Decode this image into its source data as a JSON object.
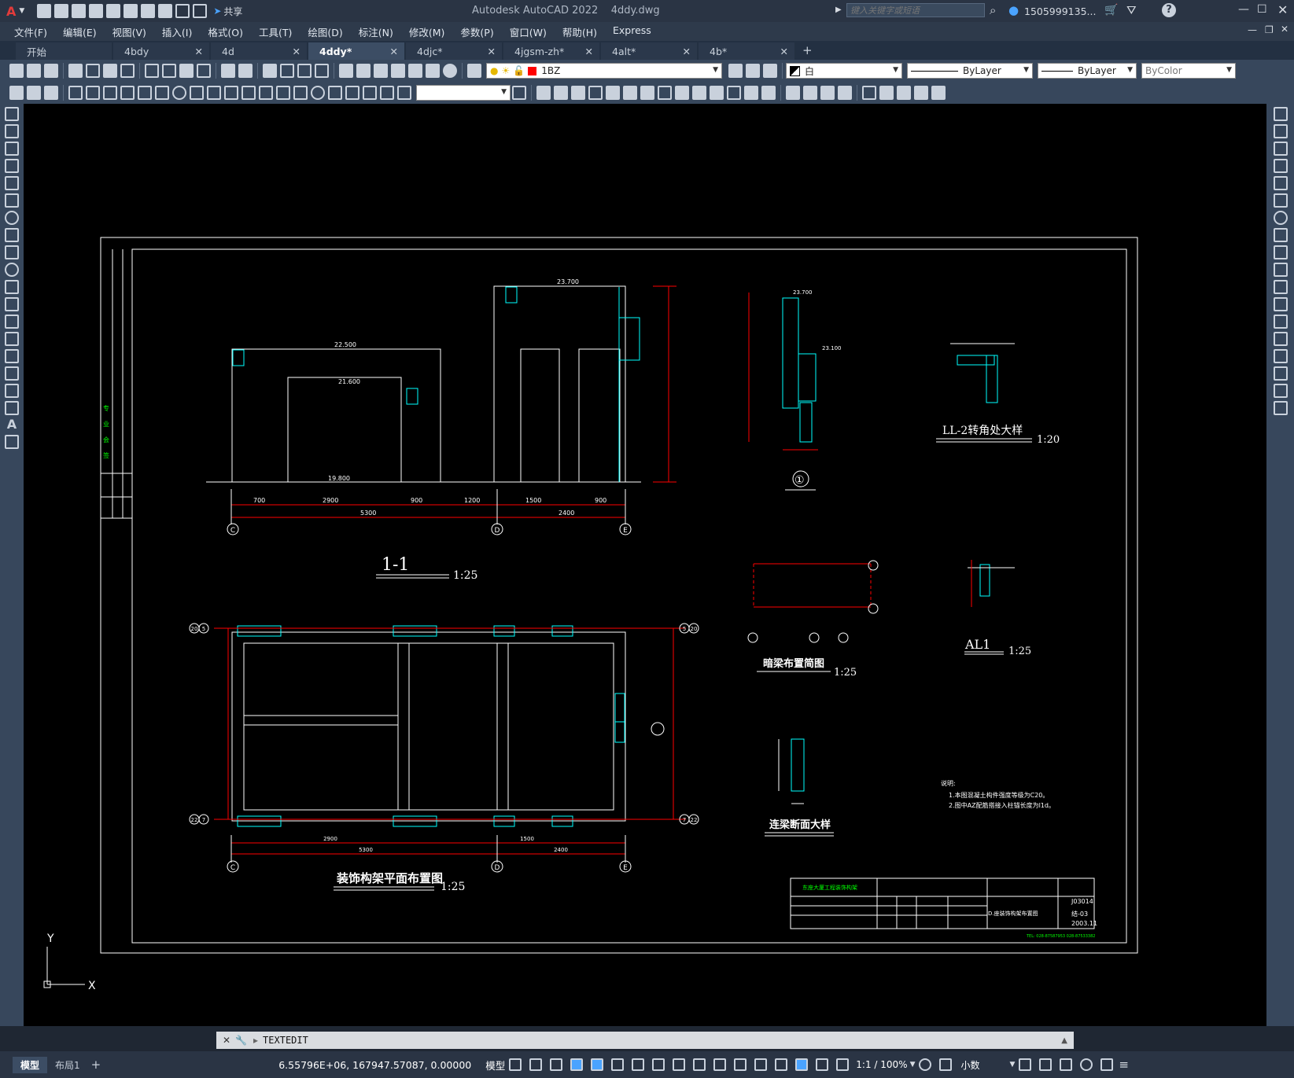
{
  "titlebar": {
    "app_title": "Autodesk AutoCAD 2022",
    "file_name": "4ddy.dwg",
    "share_label": "共享",
    "search_placeholder": "键入关键字或短语",
    "user_name": "1505999135...",
    "window_controls": [
      "minimize-icon",
      "maximize-icon",
      "close-icon"
    ]
  },
  "menubar": {
    "items": [
      "文件(F)",
      "编辑(E)",
      "视图(V)",
      "插入(I)",
      "格式(O)",
      "工具(T)",
      "绘图(D)",
      "标注(N)",
      "修改(M)",
      "参数(P)",
      "窗口(W)",
      "帮助(H)",
      "Express"
    ]
  },
  "tabs": [
    {
      "label": "开始",
      "active": false,
      "closable": false
    },
    {
      "label": "4bdy",
      "active": false,
      "closable": true
    },
    {
      "label": "4d",
      "active": false,
      "closable": true
    },
    {
      "label": "4ddy*",
      "active": true,
      "closable": true
    },
    {
      "label": "4djc*",
      "active": false,
      "closable": true
    },
    {
      "label": "4jgsm-zh*",
      "active": false,
      "closable": true
    },
    {
      "label": "4alt*",
      "active": false,
      "closable": true
    },
    {
      "label": "4b*",
      "active": false,
      "closable": true
    }
  ],
  "properties": {
    "layer": "1BZ",
    "color": "白",
    "linetype": "ByLayer",
    "lineweight": "ByLayer",
    "plotstyle": "ByColor",
    "layer_color": "#ff0000"
  },
  "drawing": {
    "section_title": "1-1",
    "section_scale": "1:25",
    "plan_title": "装饰构架平面布置图",
    "plan_scale": "1:25",
    "detail1_label": "①",
    "detail2_title": "LL-2转角处大样",
    "detail2_scale": "1:20",
    "detail3_title": "暗梁布置简图",
    "detail3_scale": "1:25",
    "detail4_title": "AL1",
    "detail4_scale": "1:25",
    "detail5_title": "连梁断面大样",
    "elev_top": "23.700",
    "elev_mid": "22.500",
    "elev_low": "21.600",
    "elev_base": "19.800",
    "elev_d1": "23.100",
    "dim_total": "5300",
    "dim_2400": "2400",
    "dim_2900": "2900",
    "dim_1500": "1500",
    "dim_900": "900",
    "dim_700": "700",
    "dim_1200": "1200",
    "axis_c": "C",
    "axis_d": "D",
    "axis_e": "E",
    "axis_20": "20",
    "axis_5": "5",
    "axis_22": "22",
    "axis_7": "7",
    "notes_label": "说明:",
    "note1": "1.本图混凝土构件强度等级为C20。",
    "note2": "2.图中AZ配筋搭接入柱锚长度为l1d。",
    "tb_project": "东座大厦工程装饰构架",
    "tb_drawing": "D.座装饰构架布置图",
    "tb_no": "J03014",
    "tb_code": "结-03",
    "tb_date": "2003.11",
    "tb_tel": "TEL: 028-87587953 028-87533382"
  },
  "command": {
    "text": "TEXTEDIT"
  },
  "status": {
    "coords": "6.55796E+06, 167947.57087, 0.00000",
    "model_label": "模型",
    "scale": "1:1 / 100%",
    "units": "小数"
  },
  "layout_tabs": [
    "模型",
    "布局1"
  ],
  "ucs": {
    "x": "X",
    "y": "Y"
  }
}
